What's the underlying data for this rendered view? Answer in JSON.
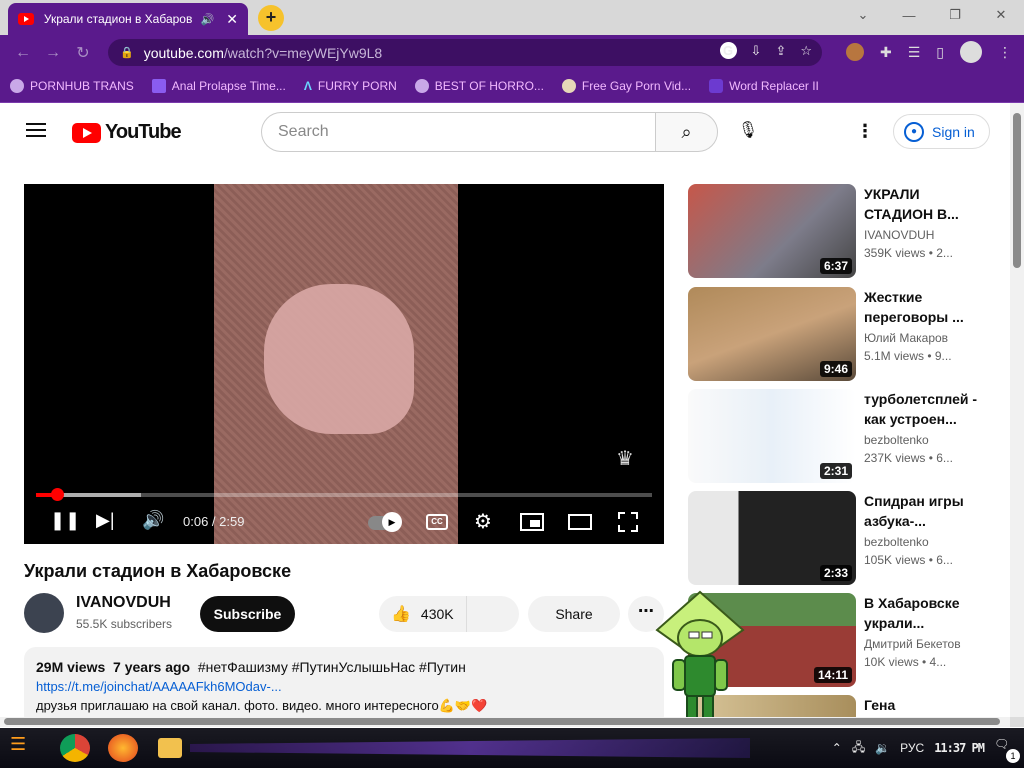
{
  "browser": {
    "tab_title": "Украли стадион в Хабаров",
    "tab_audio_icon": "speaker-icon",
    "tab_close": "✕",
    "new_tab": "+",
    "url_domain": "youtube.com",
    "url_path": "/watch?v=meyWEjYw9L8",
    "window_controls": [
      "⌄",
      "—",
      "❐",
      "✕"
    ],
    "bookmarks": [
      {
        "label": "PORNHUB TRANS",
        "icon": "globe-icon"
      },
      {
        "label": "Anal Prolapse Time...",
        "icon": "bookmark-icon"
      },
      {
        "label": "FURRY PORN",
        "icon": "lambda-icon"
      },
      {
        "label": "BEST OF HORRO...",
        "icon": "globe-icon"
      },
      {
        "label": "Free Gay Porn Vid...",
        "icon": "bookmark-icon"
      },
      {
        "label": "Word Replacer II",
        "icon": "extension-icon"
      }
    ]
  },
  "youtube": {
    "logo_text": "YouTube",
    "search_placeholder": "Search",
    "sign_in_label": "Sign in"
  },
  "player": {
    "time_current": "0:06",
    "time_total": "2:59",
    "time_display": "0:06 / 2:59",
    "progress_fraction": 0.034,
    "buffered_fraction": 0.17,
    "cc_label": "CC",
    "watermark_icon": "channel-watermark-icon"
  },
  "video": {
    "title": "Украли стадион в Хабаровске",
    "channel": "IVANOVDUH",
    "subscribers": "55.5K subscribers",
    "subscribe_label": "Subscribe",
    "likes": "430K",
    "share_label": "Share",
    "more_label": "⋯",
    "views": "29M views",
    "age": "7 years ago",
    "hashtags": "#нетФашизму #ПутинУслышьНас #Путин",
    "link": "https://t.me/joinchat/AAAAAFkh6MOdav-...",
    "desc_line": "друзья приглашаю на свой канал. фото. видео. много интересного💪🤝❤️"
  },
  "related": [
    {
      "title": "УКРАЛИ СТАДИОН В...",
      "channel": "IVANOVDUH",
      "meta": "359K views • 2...",
      "duration": "6:37"
    },
    {
      "title": "Жесткие переговоры ...",
      "channel": "Юлий Макаров",
      "meta": "5.1M views • 9...",
      "duration": "9:46"
    },
    {
      "title": "турболетсплей - как устроен...",
      "channel": "bezboltenko",
      "meta": "237K views • 6...",
      "duration": "2:31"
    },
    {
      "title": "Спидран игры азбука-...",
      "channel": "bezboltenko",
      "meta": "105K views • 6...",
      "duration": "2:33"
    },
    {
      "title": "В Хабаровске украли...",
      "channel": "Дмитрий Бекетов",
      "meta": "10K views • 4...",
      "duration": "14:11"
    },
    {
      "title": "Гена",
      "channel": "",
      "meta": "",
      "duration": ""
    }
  ],
  "taskbar": {
    "lang": "РУС",
    "clock": "11:37 PM",
    "notif_count": "1"
  }
}
